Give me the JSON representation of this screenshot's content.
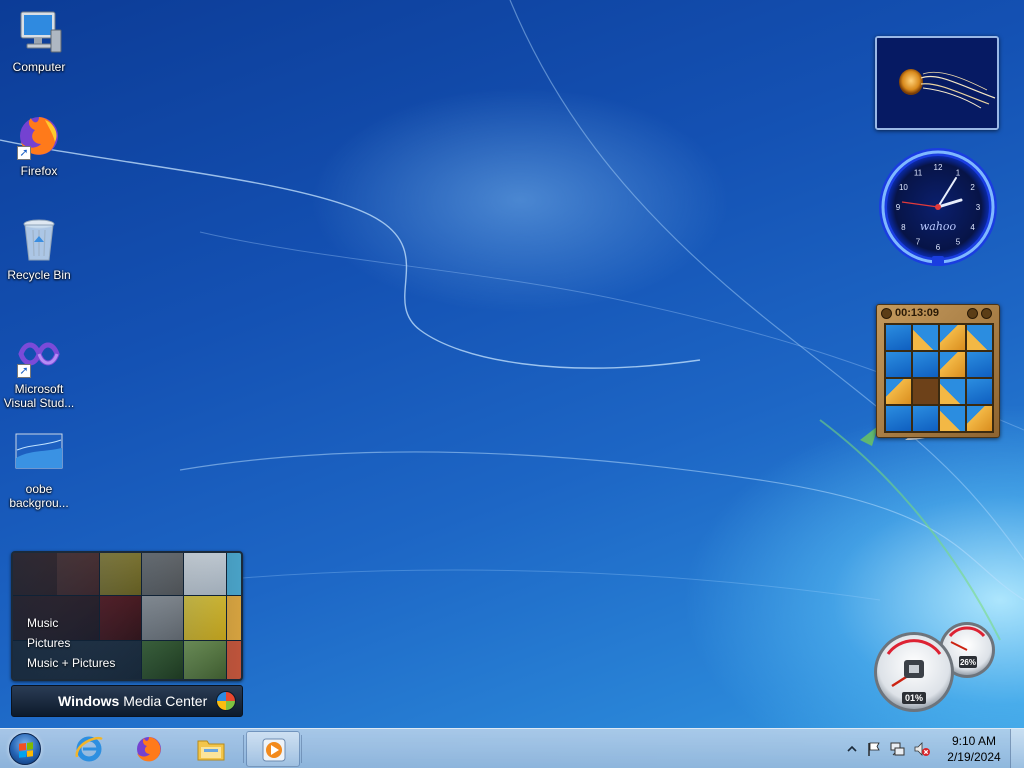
{
  "desktop": {
    "icons": [
      {
        "label": "Computer",
        "icon": "computer-icon"
      },
      {
        "label": "Firefox",
        "icon": "firefox-icon"
      },
      {
        "label": "Recycle Bin",
        "icon": "recycle-bin-icon"
      },
      {
        "label": "Microsoft Visual Stud...",
        "icon": "visual-studio-icon"
      },
      {
        "label": "oobe backgrou...",
        "icon": "image-file-icon"
      }
    ]
  },
  "gadgets": {
    "slideshow": {
      "icon": "jellyfish-photo"
    },
    "clock": {
      "brand": "wahoo",
      "numerals": [
        "12",
        "1",
        "2",
        "3",
        "4",
        "5",
        "6",
        "7",
        "8",
        "9",
        "10",
        "11"
      ]
    },
    "puzzle": {
      "timer": "00:13:09"
    },
    "cpu_meter": {
      "cpu": "01%",
      "memory": "26%",
      "cpu_fraction": 0.01,
      "memory_fraction": 0.26
    }
  },
  "media_center": {
    "menu": [
      "Music",
      "Pictures",
      "Music + Pictures"
    ],
    "title_bold": "Windows",
    "title_rest": " Media Center"
  },
  "taskbar": {
    "pinned": [
      {
        "name": "internet-explorer",
        "icon": "internet-explorer-icon"
      },
      {
        "name": "firefox",
        "icon": "firefox-icon"
      },
      {
        "name": "file-explorer",
        "icon": "folder-icon"
      },
      {
        "name": "windows-media-player",
        "icon": "media-player-icon"
      }
    ],
    "tray": {
      "time": "9:10 AM",
      "date": "2/19/2024"
    }
  }
}
